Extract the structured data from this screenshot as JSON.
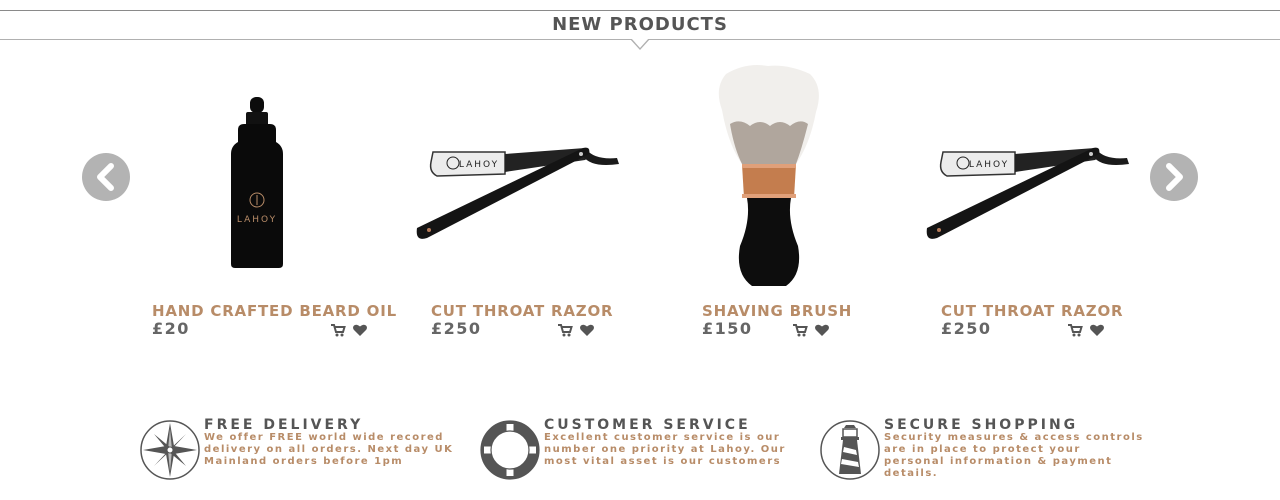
{
  "section": {
    "title": "NEW PRODUCTS"
  },
  "carousel": {
    "prev_icon": "chevron-left-icon",
    "next_icon": "chevron-right-icon",
    "arrow_color": "#b3b3b3"
  },
  "products": [
    {
      "name": "HAND CRAFTED BEARD OIL",
      "price": "£20",
      "image": "beard-oil-bottle",
      "brand_label": "LAHOY"
    },
    {
      "name": "CUT  THROAT RAZOR",
      "price": "£250",
      "image": "straight-razor",
      "brand_label": "LAHOY"
    },
    {
      "name": "SHAVING BRUSH",
      "price": "£150",
      "image": "shaving-brush"
    },
    {
      "name": "CUT  THROAT RAZOR",
      "price": "£250",
      "image": "straight-razor",
      "brand_label": "LAHOY"
    }
  ],
  "product_actions": {
    "cart_icon": "cart-icon",
    "wishlist_icon": "heart-icon"
  },
  "features": [
    {
      "title": "FREE DELIVERY",
      "text": "We offer FREE world wide recored delivery on all orders. Next day UK Mainland orders before 1pm",
      "icon": "compass-rose-icon"
    },
    {
      "title": "CUSTOMER SERVICE",
      "text": "Excellent customer service is our number one priority at Lahoy. Our most vital asset is our customers",
      "icon": "lifebuoy-icon"
    },
    {
      "title": "SECURE SHOPPING",
      "text": "Security measures & access controls are in place to protect your personal information & payment details.",
      "icon": "lighthouse-icon"
    }
  ],
  "colors": {
    "accent": "#b88c68",
    "heading": "#555555",
    "price": "#666666"
  }
}
